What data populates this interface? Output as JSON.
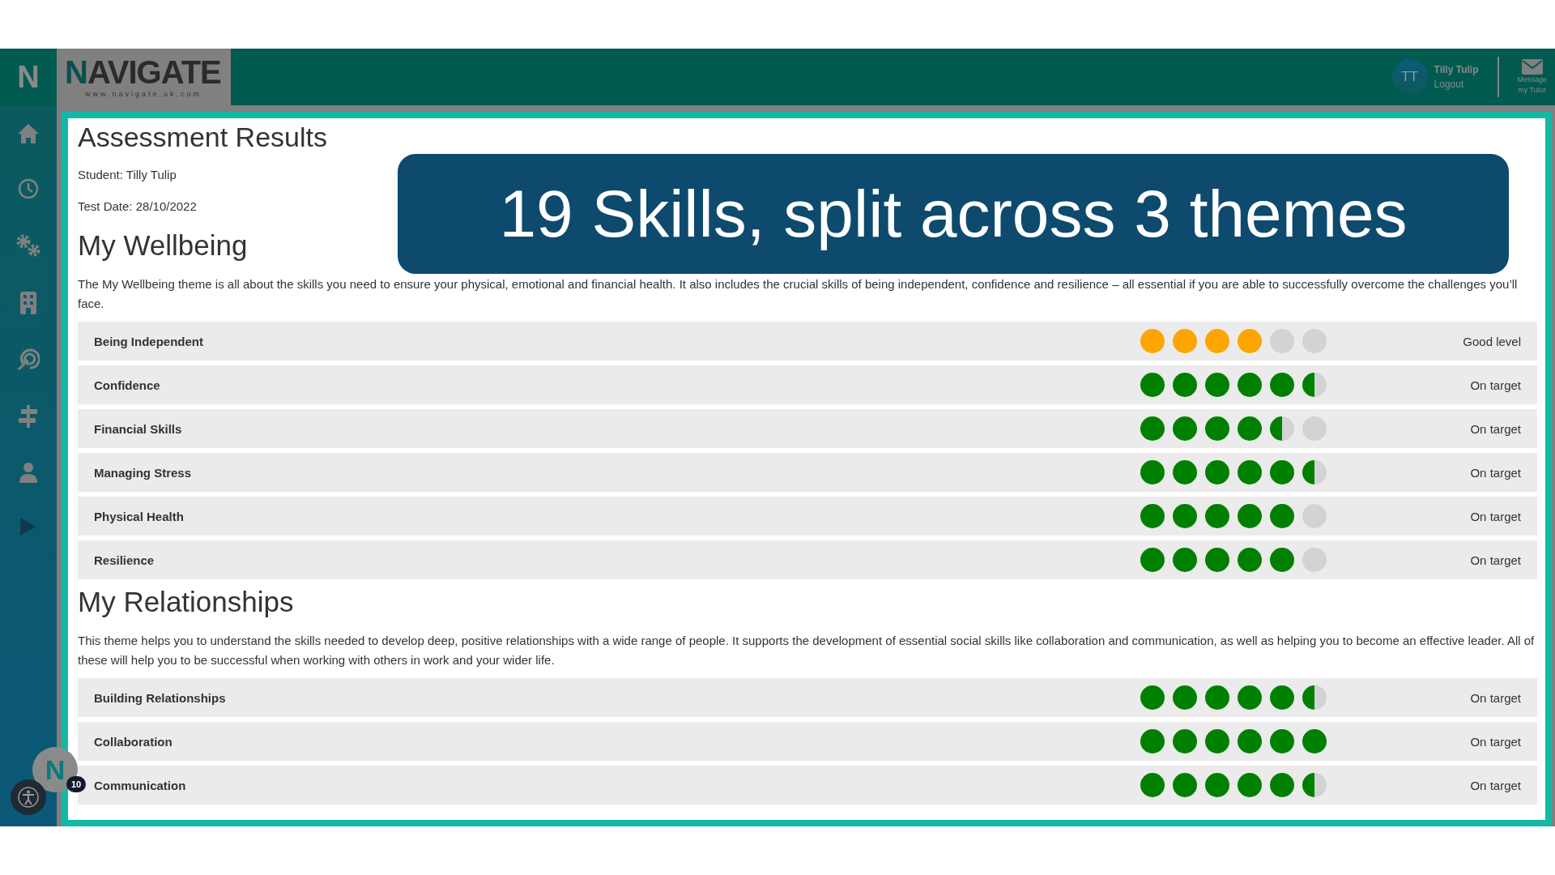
{
  "header": {
    "sidebar_mark": "N",
    "logo": "NAVIGATE",
    "logo_url": "www.navigate.uk.com",
    "user": {
      "initials": "TT",
      "name": "Tilly Tulip",
      "logout": "Logout"
    },
    "message_button": {
      "line_1": "Message",
      "line_2": "my Tutor"
    }
  },
  "page": {
    "title": "Assessment Results",
    "student": "Student: Tilly Tulip",
    "test_date": "Test Date: 28/10/2022"
  },
  "banner": "19 Skills, split across 3 themes",
  "themes": [
    {
      "title": "My Wellbeing",
      "description": "The My Wellbeing theme is all about the skills you need to ensure your physical, emotional and financial health. It also includes the crucial skills of being independent, confidence and resilience – all essential if you are able to successfully overcome the challenges you’ll face.",
      "skills": [
        {
          "name": "Being Independent",
          "stars": 4,
          "color": "#ffa500",
          "status": "Good level"
        },
        {
          "name": "Confidence",
          "stars": 5.5,
          "color": "#008000",
          "status": "On target"
        },
        {
          "name": "Financial Skills",
          "stars": 4.5,
          "color": "#008000",
          "status": "On target"
        },
        {
          "name": "Managing Stress",
          "stars": 5.5,
          "color": "#008000",
          "status": "On target"
        },
        {
          "name": "Physical Health",
          "stars": 5,
          "color": "#008000",
          "status": "On target"
        },
        {
          "name": "Resilience",
          "stars": 5,
          "color": "#008000",
          "status": "On target"
        }
      ]
    },
    {
      "title": "My Relationships",
      "description": "This theme helps you to understand the skills needed to develop deep, positive relationships with a wide range of people. It supports the development of essential social skills like collaboration and communication, as well as helping you to become an effective leader. All of these will help you to be successful when working with others in work and your wider life.",
      "skills": [
        {
          "name": "Building Relationships",
          "stars": 5.5,
          "color": "#008000",
          "status": "On target"
        },
        {
          "name": "Collaboration",
          "stars": 6,
          "color": "#008000",
          "status": "On target"
        },
        {
          "name": "Communication",
          "stars": 5.5,
          "color": "#008000",
          "status": "On target"
        }
      ]
    }
  ],
  "help": {
    "mark": "N",
    "badge": "10"
  }
}
